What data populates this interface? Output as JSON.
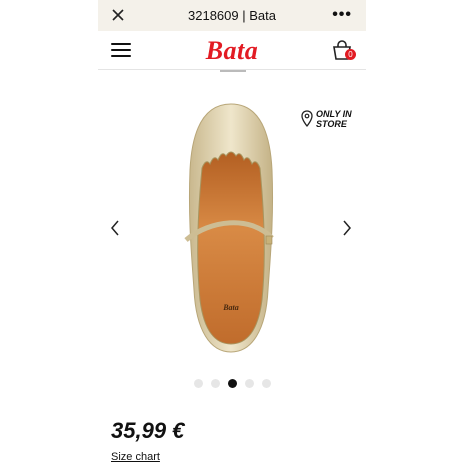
{
  "browser": {
    "title": "3218609 | Bata",
    "more": "•••"
  },
  "header": {
    "logo": "Bata",
    "cart_count": "0"
  },
  "product": {
    "availability": "ONLY IN STORE",
    "availability_line1": "ONLY IN",
    "availability_line2": "STORE",
    "price": "35,99 €",
    "size_chart": "Size chart",
    "carousel": {
      "total": 5,
      "active": 3
    }
  },
  "colors": {
    "brand": "#e21b23",
    "shoe": "#d8c9a3",
    "lining": "#c8732f"
  },
  "icons": [
    "close-icon",
    "menu-icon",
    "cart-icon",
    "location-pin-icon",
    "chevron-left-icon",
    "chevron-right-icon"
  ]
}
